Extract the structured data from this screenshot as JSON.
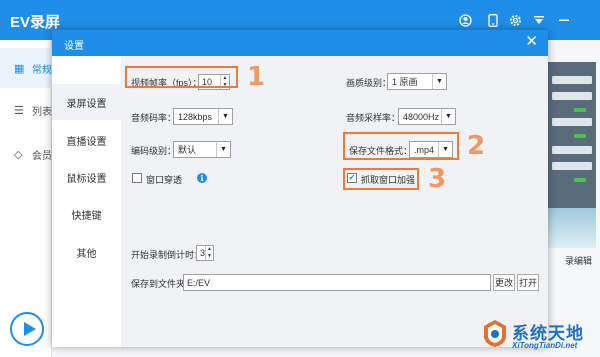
{
  "app": {
    "title": "EV录屏",
    "sidebar": [
      {
        "label": "常规",
        "icon": "grid-icon"
      },
      {
        "label": "列表",
        "icon": "list-icon"
      },
      {
        "label": "会员",
        "icon": "diamond-icon"
      }
    ],
    "edit_label": "录编辑"
  },
  "dialog": {
    "title": "设置",
    "close_label": "✕",
    "nav": [
      "录屏设置",
      "直播设置",
      "鼠标设置",
      "快捷键",
      "其他"
    ],
    "fps_label": "视频帧率（fps）：",
    "fps_value": "10",
    "quality_label": "画质级别：",
    "quality_value": "1 原画",
    "video_bitrate_label": "音频码率：",
    "video_bitrate_value": "128kbps",
    "audio_sample_label": "音频采样率：",
    "audio_sample_value": "48000Hz",
    "encode_label": "编码级别：",
    "encode_value": "默认",
    "format_label": "保存文件格式：",
    "format_value": ".mp4",
    "window_pass_label": "窗口穿透",
    "window_pass_checked": false,
    "capture_enhance_label": "抓取窗口加强",
    "capture_enhance_checked": true,
    "countdown_label": "开始录制倒计时：",
    "countdown_value": "3",
    "save_folder_label": "保存到文件夹：",
    "save_folder_value": "E:/EV",
    "change_label": "更改",
    "open_label": "打开"
  },
  "annotations": [
    "1",
    "2",
    "3"
  ],
  "watermark": {
    "name": "系统天地",
    "url": "XiTongTianDi.net"
  },
  "colors": {
    "accent": "#1f8ee8",
    "highlight": "#f07a35"
  }
}
